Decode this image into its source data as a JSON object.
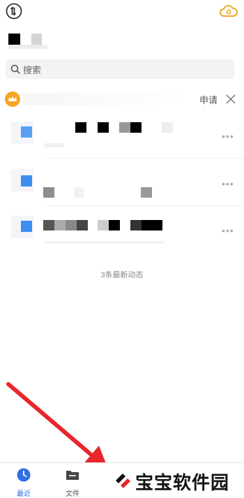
{
  "search": {
    "placeholder": "搜索"
  },
  "banner": {
    "action_label": "申请"
  },
  "activity": {
    "items": [
      {
        "thumb_color": "#3c8ff0"
      },
      {
        "thumb_color": "#3c8ff0"
      },
      {
        "thumb_color": "#3c8ff0"
      }
    ],
    "summary": "3条最新动态"
  },
  "nav": {
    "recent": "最近",
    "files": "文件"
  },
  "watermark": {
    "text": "宝宝软件园"
  },
  "colors": {
    "accent": "#2f6fe2",
    "crown": "#f5a623",
    "cloud": "#f5a623",
    "arrow": "#e8262c"
  }
}
